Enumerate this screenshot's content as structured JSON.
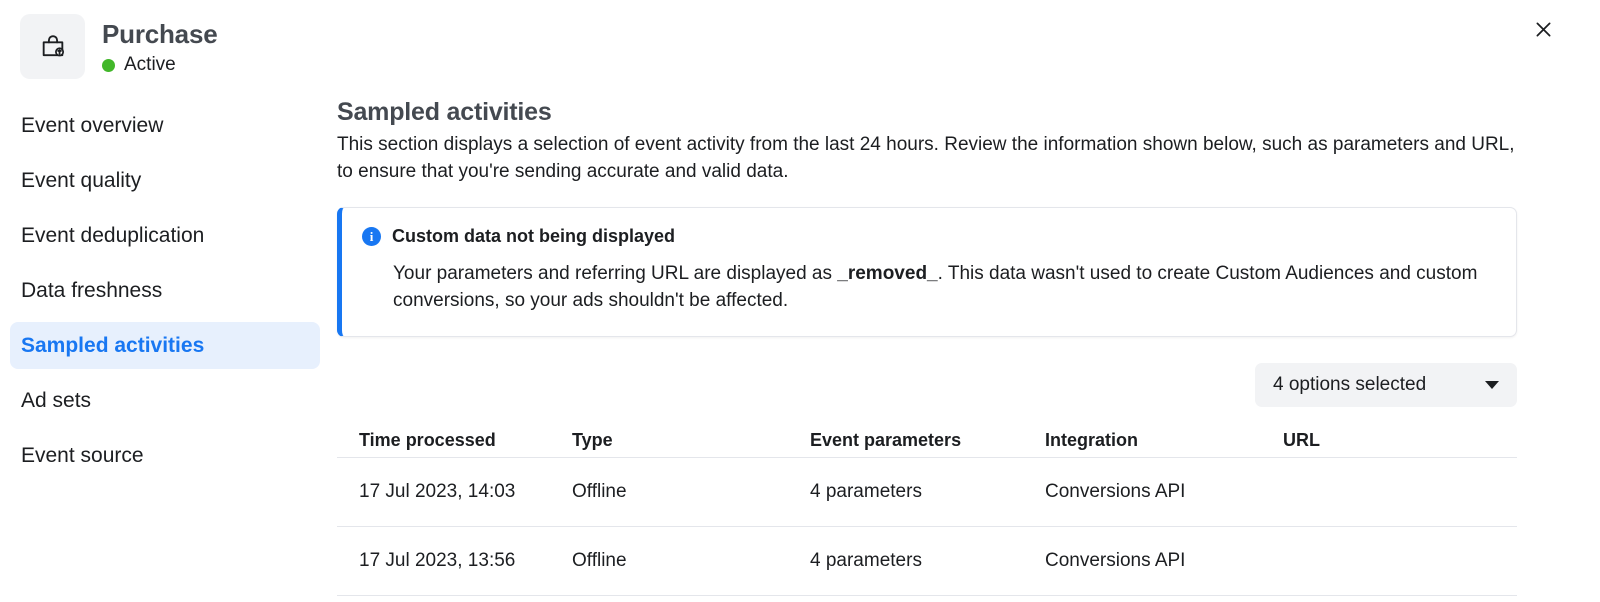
{
  "header": {
    "event_icon": "shopping-bag-icon",
    "title": "Purchase",
    "status_label": "Active",
    "status_color": "#42b72a",
    "close_icon": "close-icon"
  },
  "sidebar": {
    "items": [
      {
        "label": "Event overview",
        "active": false
      },
      {
        "label": "Event quality",
        "active": false
      },
      {
        "label": "Event deduplication",
        "active": false
      },
      {
        "label": "Data freshness",
        "active": false
      },
      {
        "label": "Sampled activities",
        "active": true
      },
      {
        "label": "Ad sets",
        "active": false
      },
      {
        "label": "Event source",
        "active": false
      }
    ],
    "active_color": "#1877f2",
    "active_background": "#e7f0fd"
  },
  "main": {
    "section_title": "Sampled activities",
    "section_description": "This section displays a selection of event activity from the last 24 hours. Review the information shown below, such as parameters and URL, to ensure that you're sending accurate and valid data.",
    "notice": {
      "icon": "info-icon",
      "accent_color": "#1877f2",
      "title": "Custom data not being displayed",
      "body_part_1": "Your parameters and referring URL are displayed as ",
      "body_emphasis": "_removed_",
      "body_part_2": ". This data wasn't used to create Custom Audiences and custom conversions, so your ads shouldn't be affected."
    },
    "filter": {
      "selected_label": "4 options selected",
      "caret_icon": "chevron-down-icon"
    },
    "table": {
      "columns": [
        "Time processed",
        "Type",
        "Event parameters",
        "Integration",
        "URL"
      ],
      "rows": [
        {
          "time_processed": "17 Jul 2023, 14:03",
          "type": "Offline",
          "event_parameters": "4 parameters",
          "integration": "Conversions API",
          "url": ""
        },
        {
          "time_processed": "17 Jul 2023, 13:56",
          "type": "Offline",
          "event_parameters": "4 parameters",
          "integration": "Conversions API",
          "url": ""
        }
      ]
    }
  }
}
